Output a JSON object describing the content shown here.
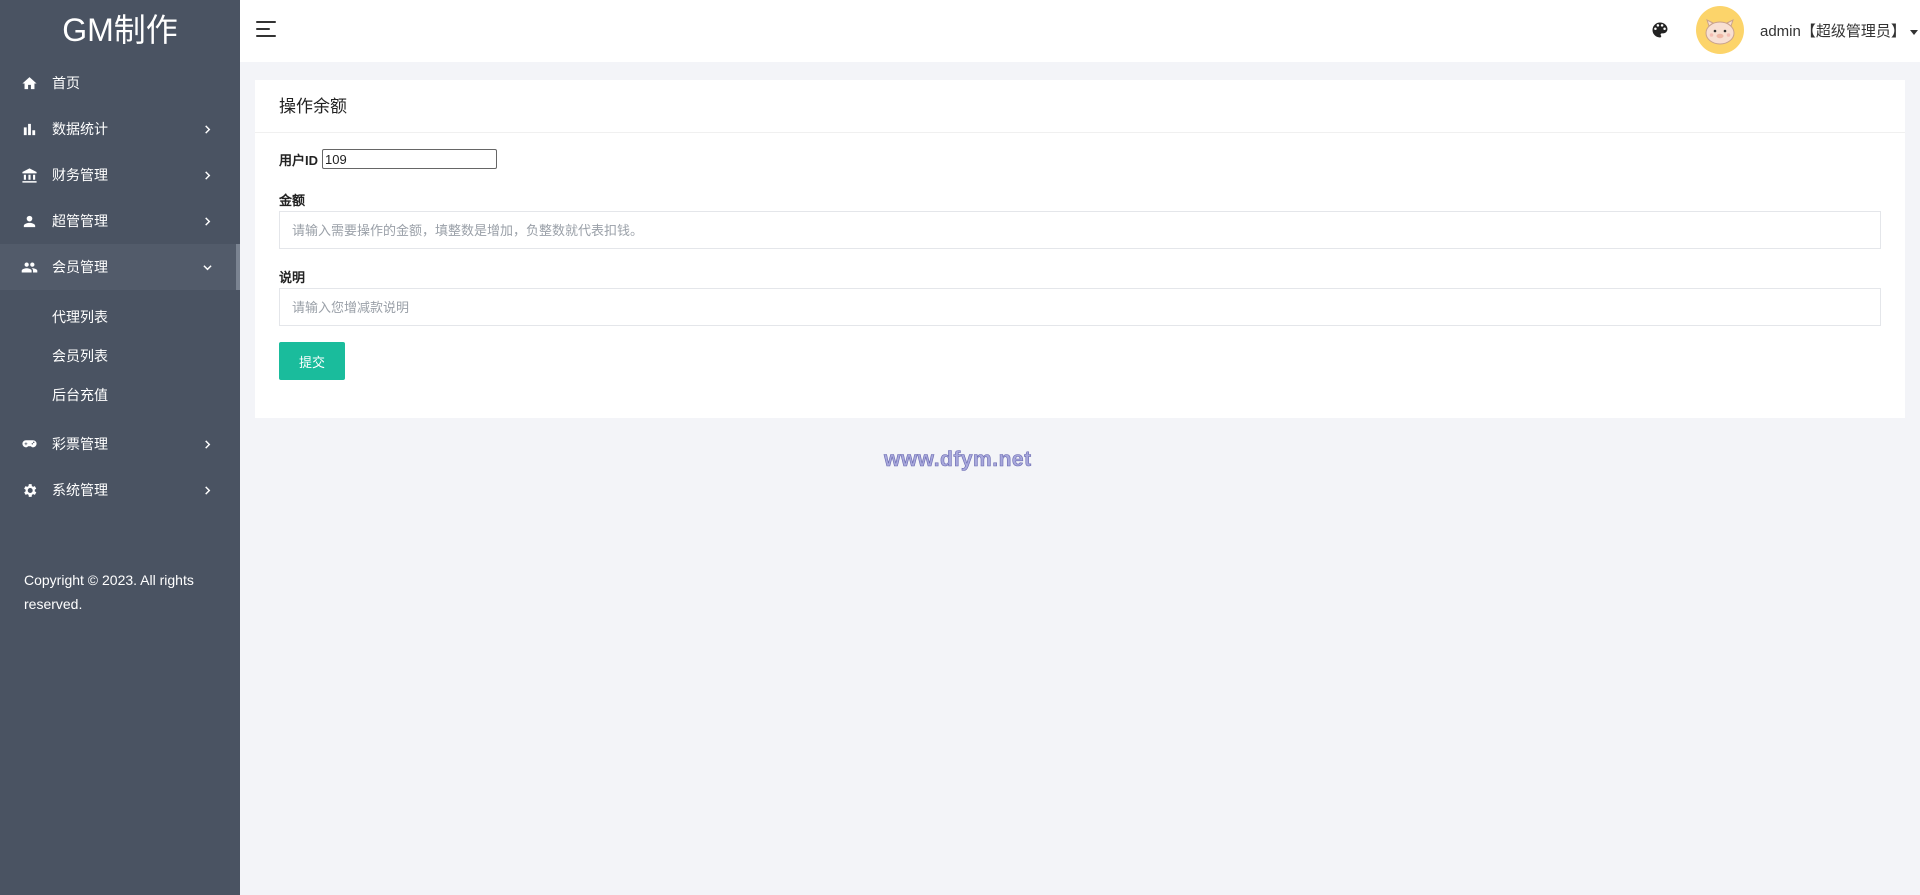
{
  "brand": "GM制作",
  "sidebar": {
    "items": [
      {
        "label": "首页",
        "icon": "home-icon"
      },
      {
        "label": "数据统计",
        "icon": "bar-chart-icon"
      },
      {
        "label": "财务管理",
        "icon": "bank-icon"
      },
      {
        "label": "超管管理",
        "icon": "person-icon"
      },
      {
        "label": "会员管理",
        "icon": "people-icon",
        "expanded": true
      },
      {
        "label": "彩票管理",
        "icon": "gamepad-icon"
      },
      {
        "label": "系统管理",
        "icon": "gear-icon"
      }
    ],
    "submenu": [
      "代理列表",
      "会员列表",
      "后台充值"
    ],
    "copyright": "Copyright © 2023. All rights reserved."
  },
  "header": {
    "user": "admin【超级管理员】"
  },
  "card": {
    "title": "操作余额",
    "uid_label": "用户ID",
    "uid_value": "109",
    "amount_label": "金额",
    "amount_placeholder": "请输入需要操作的金额，填整数是增加，负整数就代表扣钱。",
    "desc_label": "说明",
    "desc_placeholder": "请输入您增减款说明",
    "submit_label": "提交"
  },
  "watermark": "www.dfym.net",
  "colors": {
    "sidebar": "#4a5362",
    "accent": "#1abc9c",
    "background": "#f3f4f8",
    "avatar": "#fcd46a"
  }
}
